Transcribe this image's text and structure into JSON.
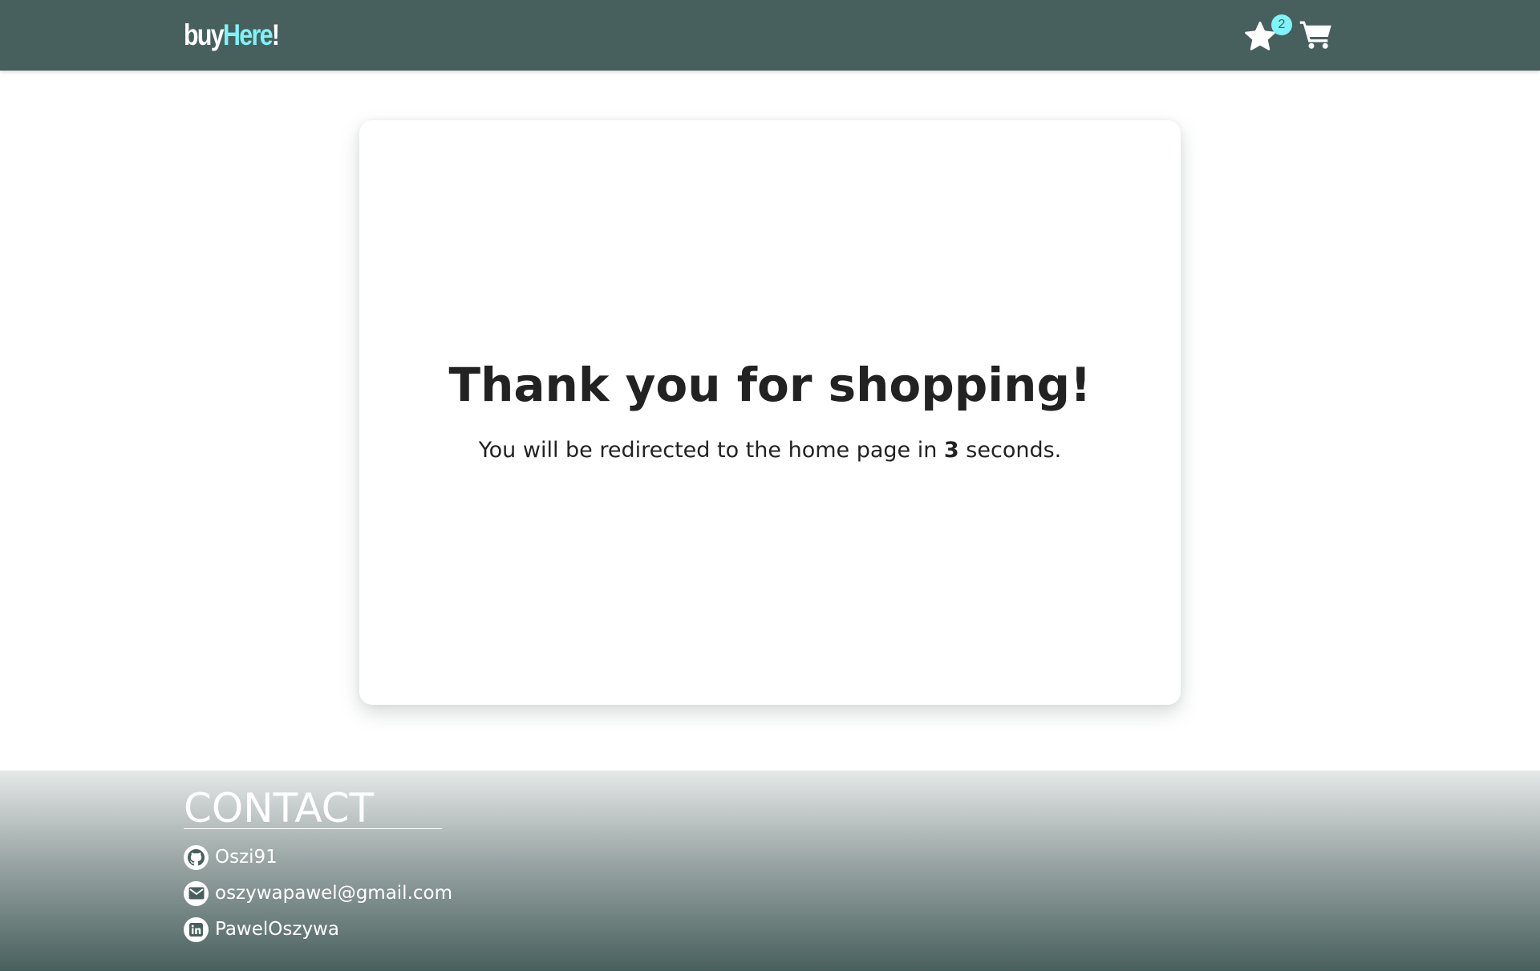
{
  "header": {
    "logo": {
      "part1": "buy",
      "part2": "Here",
      "part3": "!"
    },
    "favorites": {
      "icon": "star-icon",
      "count": "2"
    },
    "cart": {
      "icon": "cart-icon"
    }
  },
  "main": {
    "title": "Thank you for shopping!",
    "message_before": "You will be redirected to the home page in ",
    "seconds": "3",
    "message_after": " seconds."
  },
  "footer": {
    "title": "CONTACT",
    "items": [
      {
        "icon": "github-icon",
        "label": "Oszi91"
      },
      {
        "icon": "envelope-icon",
        "label": "oszywapawel@gmail.com"
      },
      {
        "icon": "linkedin-icon",
        "label": "PawelOszywa"
      }
    ]
  },
  "colors": {
    "navbar": "#48605d",
    "accent": "#7ff3f7",
    "text": "#222222",
    "footer_bottom": "#48605d"
  }
}
